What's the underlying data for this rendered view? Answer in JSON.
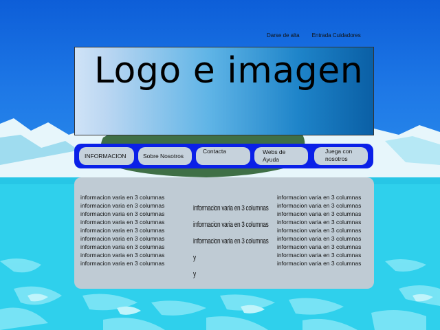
{
  "top_links": [
    "Darse de alta",
    "Entrada Cuidadores"
  ],
  "logo": {
    "text": "Logo e imagen"
  },
  "nav": [
    "INFORMACION",
    "Sobre Nosotros",
    "Contacta",
    "Webs de\nAyuda",
    "Juega con\nnosotros"
  ],
  "columns": {
    "left": [
      "informacion varia en 3 columnas",
      "informacion varia en 3 columnas",
      "informacion varia en 3 columnas",
      "informacion varia en 3 columnas",
      "informacion varia en 3 columnas",
      "informacion varia en 3 columnas",
      "informacion varia en 3 columnas",
      "informacion varia en 3 columnas",
      "informacion varia en 3 columnas"
    ],
    "middle": [
      "informacion varia en 3 columnas",
      "informacion varia en 3 columnas",
      "informacion varia en 3 columnas",
      "y",
      "y"
    ],
    "right": [
      "informacion varia en 3 columnas",
      "informacion varia en 3 columnas",
      "informacion varia en 3 columnas",
      "informacion varia en 3 columnas",
      "informacion varia en 3 columnas",
      "informacion varia en 3 columnas",
      "informacion varia en 3 columnas",
      "informacion varia en 3 columnas",
      "informacion varia en 3 columnas"
    ]
  },
  "colors": {
    "sky": "#1a6fe0",
    "sea": "#2fd0ec",
    "navbar": "#0a20e8",
    "button": "#c6d2dc",
    "panel": "#bfcbd4"
  }
}
